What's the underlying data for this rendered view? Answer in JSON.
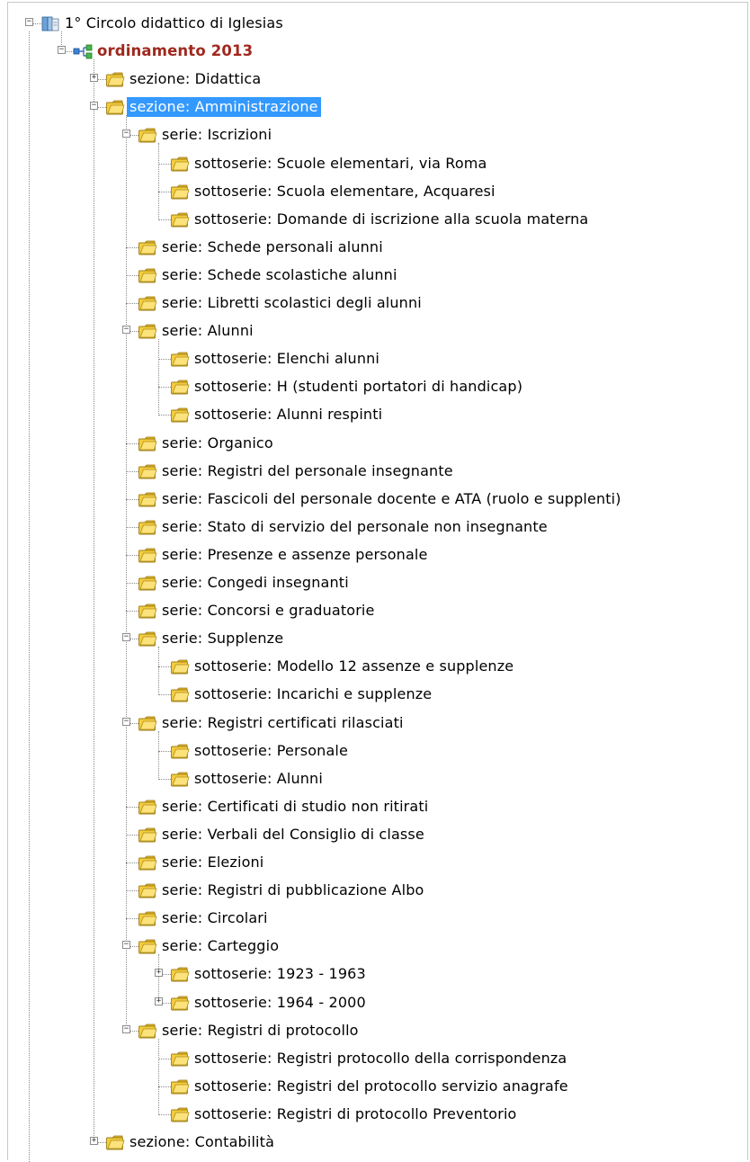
{
  "tree": [
    {
      "label": "1° Circolo didattico di Iglesias",
      "level": 0,
      "icon": "archive-icon",
      "expander": "minus"
    },
    {
      "label": "ordinamento 2013",
      "level": 1,
      "icon": "hierarchy-icon",
      "expander": "minus",
      "style": "bold"
    },
    {
      "label": "sezione: Didattica",
      "level": 2,
      "icon": "folder-icon",
      "expander": "plus"
    },
    {
      "label": "sezione: Amministrazione",
      "level": 2,
      "icon": "folder-icon",
      "expander": "minus",
      "selected": true
    },
    {
      "label": "serie: Iscrizioni",
      "level": 3,
      "icon": "folder-icon",
      "expander": "minus"
    },
    {
      "label": "sottoserie: Scuole elementari, via Roma",
      "level": 4,
      "icon": "folder-icon"
    },
    {
      "label": "sottoserie: Scuola elementare, Acquaresi",
      "level": 4,
      "icon": "folder-icon"
    },
    {
      "label": "sottoserie: Domande di iscrizione alla scuola materna",
      "level": 4,
      "icon": "folder-icon"
    },
    {
      "label": "serie: Schede personali alunni",
      "level": 3,
      "icon": "folder-icon"
    },
    {
      "label": "serie: Schede scolastiche alunni",
      "level": 3,
      "icon": "folder-icon"
    },
    {
      "label": "serie: Libretti scolastici degli alunni",
      "level": 3,
      "icon": "folder-icon"
    },
    {
      "label": "serie: Alunni",
      "level": 3,
      "icon": "folder-icon",
      "expander": "minus"
    },
    {
      "label": "sottoserie: Elenchi alunni",
      "level": 4,
      "icon": "folder-icon"
    },
    {
      "label": "sottoserie: H (studenti portatori di handicap)",
      "level": 4,
      "icon": "folder-icon"
    },
    {
      "label": "sottoserie: Alunni respinti",
      "level": 4,
      "icon": "folder-icon"
    },
    {
      "label": "serie: Organico",
      "level": 3,
      "icon": "folder-icon"
    },
    {
      "label": "serie: Registri del personale insegnante",
      "level": 3,
      "icon": "folder-icon"
    },
    {
      "label": "serie: Fascicoli del personale docente e ATA (ruolo e supplenti)",
      "level": 3,
      "icon": "folder-icon"
    },
    {
      "label": "serie: Stato di servizio del personale non insegnante",
      "level": 3,
      "icon": "folder-icon"
    },
    {
      "label": "serie: Presenze e assenze personale",
      "level": 3,
      "icon": "folder-icon"
    },
    {
      "label": "serie: Congedi insegnanti",
      "level": 3,
      "icon": "folder-icon"
    },
    {
      "label": "serie: Concorsi e graduatorie",
      "level": 3,
      "icon": "folder-icon"
    },
    {
      "label": "serie: Supplenze",
      "level": 3,
      "icon": "folder-icon",
      "expander": "minus"
    },
    {
      "label": "sottoserie: Modello 12 assenze e supplenze",
      "level": 4,
      "icon": "folder-icon"
    },
    {
      "label": "sottoserie: Incarichi e supplenze",
      "level": 4,
      "icon": "folder-icon"
    },
    {
      "label": "serie: Registri certificati rilasciati",
      "level": 3,
      "icon": "folder-icon",
      "expander": "minus"
    },
    {
      "label": "sottoserie: Personale",
      "level": 4,
      "icon": "folder-icon"
    },
    {
      "label": "sottoserie: Alunni",
      "level": 4,
      "icon": "folder-icon"
    },
    {
      "label": "serie: Certificati di studio non ritirati",
      "level": 3,
      "icon": "folder-icon"
    },
    {
      "label": "serie: Verbali del Consiglio di classe",
      "level": 3,
      "icon": "folder-icon"
    },
    {
      "label": "serie: Elezioni",
      "level": 3,
      "icon": "folder-icon"
    },
    {
      "label": "serie: Registri di pubblicazione Albo",
      "level": 3,
      "icon": "folder-icon"
    },
    {
      "label": "serie: Circolari",
      "level": 3,
      "icon": "folder-icon"
    },
    {
      "label": "serie: Carteggio",
      "level": 3,
      "icon": "folder-icon",
      "expander": "minus"
    },
    {
      "label": "sottoserie: 1923 - 1963",
      "level": 4,
      "icon": "folder-icon",
      "expander": "plus"
    },
    {
      "label": "sottoserie: 1964 - 2000",
      "level": 4,
      "icon": "folder-icon",
      "expander": "plus"
    },
    {
      "label": "serie: Registri di protocollo",
      "level": 3,
      "icon": "folder-icon",
      "expander": "minus"
    },
    {
      "label": "sottoserie: Registri protocollo della corrispondenza",
      "level": 4,
      "icon": "folder-icon"
    },
    {
      "label": "sottoserie: Registri del protocollo servizio anagrafe",
      "level": 4,
      "icon": "folder-icon"
    },
    {
      "label": "sottoserie: Registri di protocollo Preventorio",
      "level": 4,
      "icon": "folder-icon"
    },
    {
      "label": "sezione: Contabilità",
      "level": 2,
      "icon": "folder-icon",
      "expander": "plus"
    }
  ],
  "colors": {
    "selection": "#3399ff",
    "root_child_text": "#a0281e",
    "folder": "#f4cd3c",
    "guide": "#8a8a8a"
  }
}
